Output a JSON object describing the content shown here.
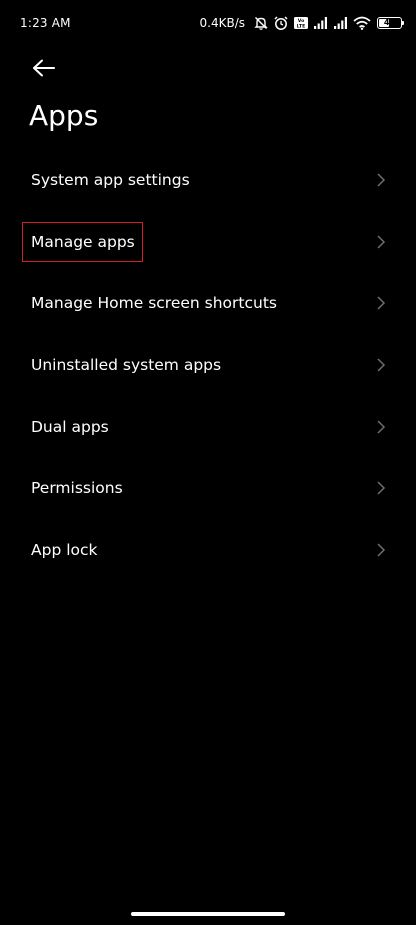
{
  "status_bar": {
    "time": "1:23 AM",
    "net_speed": "0.4KB/s",
    "battery_level": "47",
    "icons": [
      "mute-icon",
      "alarm-icon",
      "volte-icon",
      "signal-icon",
      "signal-icon",
      "wifi-icon",
      "battery-icon"
    ]
  },
  "header": {
    "back_icon": "arrow-left-icon",
    "title": "Apps"
  },
  "settings": {
    "items": [
      {
        "label": "System app settings",
        "highlighted": false
      },
      {
        "label": "Manage apps",
        "highlighted": true
      },
      {
        "label": "Manage Home screen shortcuts",
        "highlighted": false
      },
      {
        "label": "Uninstalled system apps",
        "highlighted": false
      },
      {
        "label": "Dual apps",
        "highlighted": false
      },
      {
        "label": "Permissions",
        "highlighted": false
      },
      {
        "label": "App lock",
        "highlighted": false
      }
    ]
  },
  "colors": {
    "background": "#000000",
    "text": "#ffffff",
    "chevron": "#6f6f6f",
    "highlight_box": "#d0202e"
  }
}
